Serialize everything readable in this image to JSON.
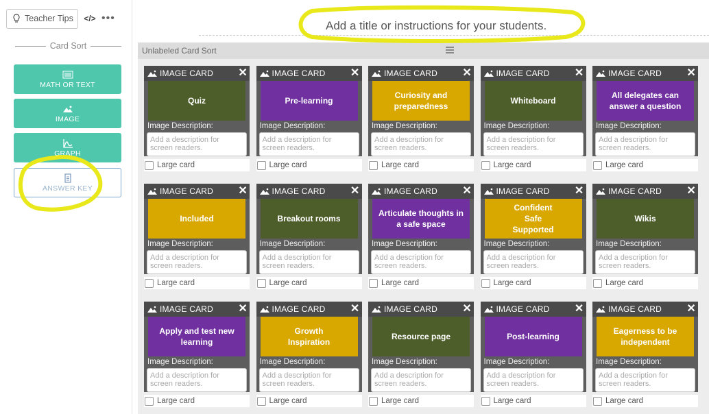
{
  "toolbar": {
    "teacher_tips_label": "Teacher Tips",
    "code_label": "</>",
    "more_label": "•••"
  },
  "sidebar": {
    "section_title": "Card Sort",
    "tools": [
      {
        "label": "MATH OR TEXT",
        "icon": "math-text-icon"
      },
      {
        "label": "IMAGE",
        "icon": "image-icon"
      },
      {
        "label": "GRAPH",
        "icon": "graph-icon"
      },
      {
        "label": "ANSWER KEY",
        "icon": "answer-key-icon"
      }
    ]
  },
  "main": {
    "title_placeholder": "Add a title or instructions for your students.",
    "sort_label": "Unlabeled Card Sort",
    "card_type_label": "IMAGE CARD",
    "description_label": "Image Description:",
    "description_placeholder": "Add a description for screen readers.",
    "large_card_label": "Large card",
    "colors": {
      "olive": "#4e5e2a",
      "purple": "#7030a0",
      "mustard": "#d9a800",
      "accent": "#4fc7ac"
    },
    "cards": [
      {
        "text": "Quiz",
        "color": "olive"
      },
      {
        "text": "Pre-learning",
        "color": "purple"
      },
      {
        "text": "Curiosity and preparedness",
        "color": "mustard"
      },
      {
        "text": "Whiteboard",
        "color": "olive"
      },
      {
        "text": "All delegates can answer a question",
        "color": "purple"
      },
      {
        "text": "Included",
        "color": "mustard"
      },
      {
        "text": "Breakout rooms",
        "color": "olive"
      },
      {
        "text": "Articulate thoughts in a safe space",
        "color": "purple"
      },
      {
        "text": "Confident\nSafe\nSupported",
        "color": "mustard"
      },
      {
        "text": "Wikis",
        "color": "olive"
      },
      {
        "text": "Apply and test new learning",
        "color": "purple"
      },
      {
        "text": "Growth\nInspiration",
        "color": "mustard"
      },
      {
        "text": "Resource page",
        "color": "olive"
      },
      {
        "text": "Post-learning",
        "color": "purple"
      },
      {
        "text": "Eagerness to be independent",
        "color": "mustard"
      }
    ]
  }
}
